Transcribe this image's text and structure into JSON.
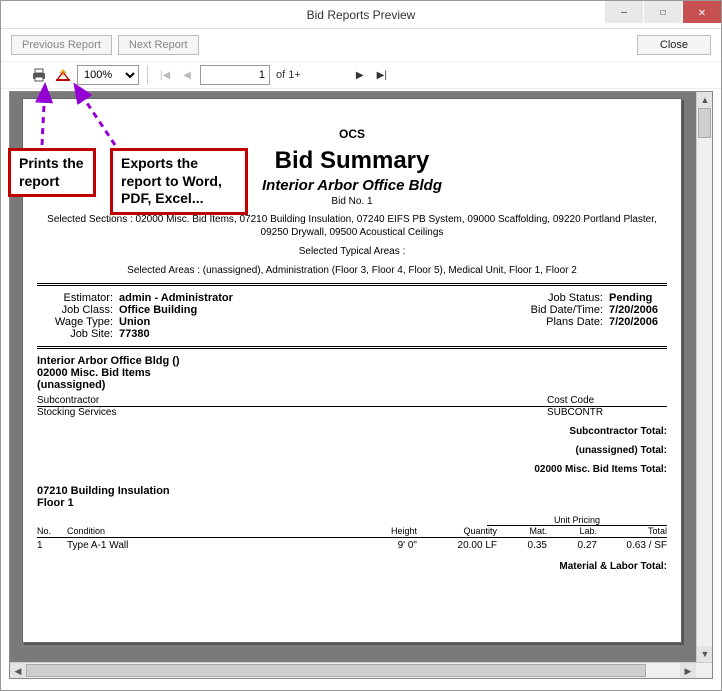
{
  "window": {
    "title": "Bid Reports Preview",
    "min_symbol": "—",
    "max_symbol": "☐",
    "close_symbol": "✕"
  },
  "buttons": {
    "prev": "Previous Report",
    "next": "Next Report",
    "close": "Close"
  },
  "toolbar": {
    "zoom": "100%",
    "page_value": "1",
    "page_of": "of 1+"
  },
  "annotations": {
    "print": "Prints the report",
    "export": "Exports the report to Word, PDF, Excel..."
  },
  "report": {
    "org": "OCS",
    "title": "Bid Summary",
    "subtitle": "Interior Arbor Office Bldg",
    "bid_no": "Bid No. 1",
    "selected_sections": "Selected Sections : 02000 Misc. Bid Items, 07210 Building Insulation, 07240 EIFS PB System, 09000 Scaffolding, 09220 Portland Plaster, 09250 Drywall, 09500 Acoustical Ceilings",
    "selected_typical": "Selected Typical Areas :",
    "selected_areas": "Selected Areas : (unassigned), Administration (Floor 3, Floor 4, Floor 5), Medical Unit, Floor 1, Floor 2",
    "meta": {
      "estimator_lbl": "Estimator:",
      "estimator": "admin - Administrator",
      "jobclass_lbl": "Job Class:",
      "jobclass": "Office Building",
      "wagetype_lbl": "Wage Type:",
      "wagetype": "Union",
      "jobsite_lbl": "Job Site:",
      "jobsite": "77380",
      "jobstatus_lbl": "Job Status:",
      "jobstatus": "Pending",
      "biddt_lbl": "Bid Date/Time:",
      "biddt": "7/20/2006",
      "plansdate_lbl": "Plans Date:",
      "plansdate": "7/20/2006"
    },
    "body": {
      "project_line": "Interior Arbor Office Bldg ()",
      "section1": "02000 Misc. Bid Items",
      "area1": "(unassigned)",
      "subcontractor_hdr": "Subcontractor",
      "costcode_hdr": "Cost Code",
      "subcontractor": "Stocking Services",
      "costcode": "SUBCONTR",
      "sub_total_lbl": "Subcontractor Total:",
      "unassigned_total_lbl": "(unassigned) Total:",
      "section1_total_lbl": "02000 Misc. Bid Items Total:",
      "section2": "07210 Building Insulation",
      "floor": "Floor 1",
      "unit_pricing": "Unit Pricing",
      "cols": {
        "no": "No.",
        "cond": "Condition",
        "height": "Height",
        "qty": "Quantity",
        "mat": "Mat.",
        "lab": "Lab.",
        "total": "Total"
      },
      "row1": {
        "no": "1",
        "cond": "Type A-1 Wall",
        "height": "9' 0\"",
        "qty": "20.00 LF",
        "mat": "0.35",
        "lab": "0.27",
        "total": "0.63 / SF"
      },
      "ml_total_lbl": "Material & Labor Total:"
    }
  }
}
